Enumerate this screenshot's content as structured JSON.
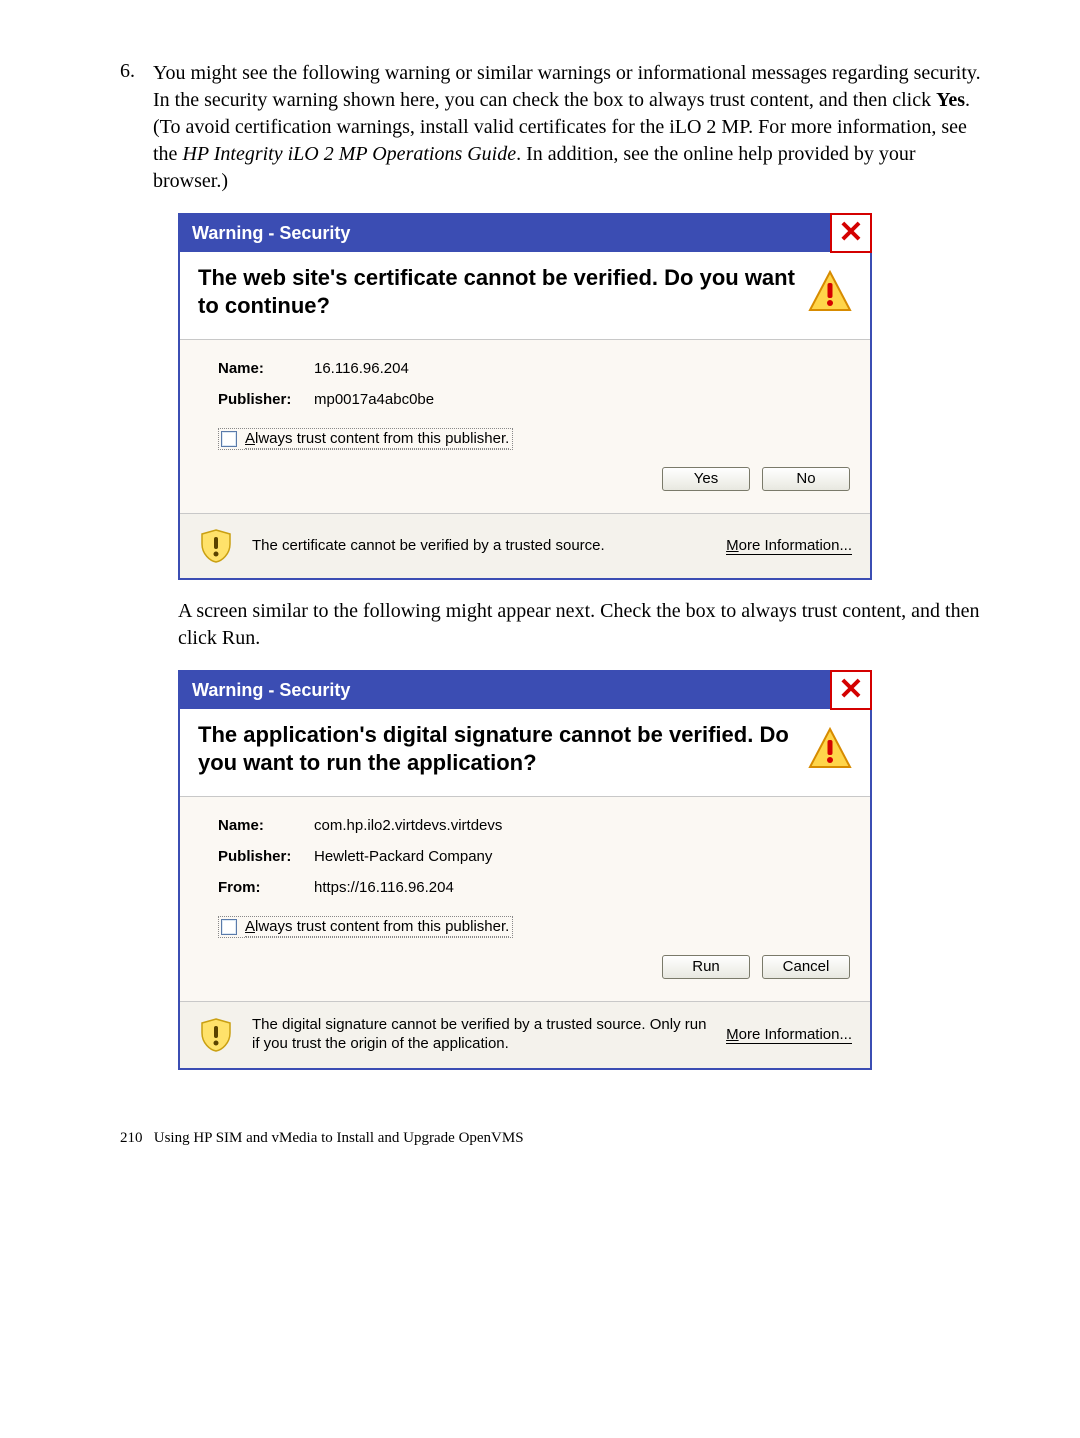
{
  "step": {
    "number": "6.",
    "text_pre": "You might see the following warning or similar warnings or informational messages regarding security. In the security warning shown here, you can check the box to always trust content, and then click ",
    "bold1": "Yes",
    "text_mid1": ". (To avoid certification warnings, install valid certificates for the iLO 2 MP. For more information, see the ",
    "italic1": "HP Integrity iLO 2 MP Operations Guide",
    "text_post": ". In addition, see the online help provided by your browser.)"
  },
  "dialog1": {
    "title": "Warning - Security",
    "heading": "The web site's certificate cannot be verified.  Do you want to continue?",
    "name_label": "Name:",
    "name_value": "16.116.96.204",
    "publisher_label": "Publisher:",
    "publisher_value": "mp0017a4abc0be",
    "checkbox_prefix": "A",
    "checkbox_rest": "lways trust content from this publisher.",
    "btn_yes": "Yes",
    "btn_no": "No",
    "footer_text": "The certificate cannot be verified by a trusted source.",
    "more_info_m": "M",
    "more_info_rest": "ore Information..."
  },
  "middle_text": {
    "pre": "A screen similar to the following might appear next. Check the box to always trust content, and then click ",
    "bold": "Run",
    "post": "."
  },
  "dialog2": {
    "title": "Warning - Security",
    "heading": "The application's digital signature cannot be verified.  Do you want to run the application?",
    "name_label": "Name:",
    "name_value": "com.hp.ilo2.virtdevs.virtdevs",
    "publisher_label": "Publisher:",
    "publisher_value": "Hewlett-Packard Company",
    "from_label": "From:",
    "from_value": "https://16.116.96.204",
    "checkbox_prefix": "A",
    "checkbox_rest": "lways trust content from this publisher.",
    "btn_run": "Run",
    "btn_cancel": "Cancel",
    "footer_text": "The digital signature cannot be verified by a trusted source.  Only run if you trust the origin of the application.",
    "more_info_m": "M",
    "more_info_rest": "ore Information..."
  },
  "page_footer": {
    "num": "210",
    "text": "Using HP SIM and vMedia to Install and Upgrade OpenVMS"
  }
}
